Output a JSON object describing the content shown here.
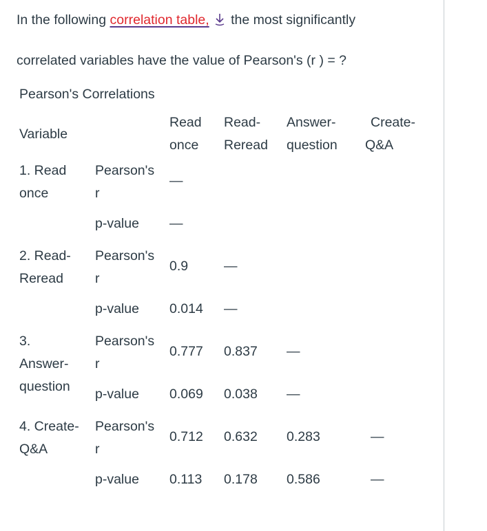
{
  "question": {
    "part1_prefix": "In the following ",
    "link_text": "correlation table,",
    "download_icon": "download-arrow-icon",
    "part1_suffix": " the most significantly",
    "part2": "correlated variables have the value of Pearson's (r ) = ?"
  },
  "table": {
    "caption": "Pearson's Correlations",
    "headers": {
      "variable": "Variable",
      "columns": [
        {
          "line1": "Read",
          "line2": "once"
        },
        {
          "line1": "Read-",
          "line2": "Reread"
        },
        {
          "line1": "Answer-",
          "line2": "question"
        },
        {
          "line1": "Create-",
          "line2": "Q&A"
        }
      ]
    },
    "rows": [
      {
        "variable_lines": [
          "1. Read",
          "once"
        ],
        "pearson_label": [
          "Pearson's",
          "r"
        ],
        "pearson": [
          "—",
          "",
          "",
          ""
        ],
        "p_label": "p-value",
        "p": [
          "—",
          "",
          "",
          ""
        ]
      },
      {
        "variable_lines": [
          "2. Read-",
          "Reread"
        ],
        "pearson_label": [
          "Pearson's",
          "r"
        ],
        "pearson": [
          "0.9",
          "—",
          "",
          ""
        ],
        "p_label": "p-value",
        "p": [
          "0.014",
          "—",
          "",
          ""
        ]
      },
      {
        "variable_lines": [
          "3.",
          "Answer-",
          "question"
        ],
        "pearson_label": [
          "Pearson's",
          "r"
        ],
        "pearson": [
          "0.777",
          "0.837",
          "—",
          ""
        ],
        "p_label": "p-value",
        "p": [
          "0.069",
          "0.038",
          "—",
          ""
        ]
      },
      {
        "variable_lines": [
          "4. Create-",
          "Q&A"
        ],
        "pearson_label": [
          "Pearson's",
          "r"
        ],
        "pearson": [
          "0.712",
          "0.632",
          "0.283",
          "—"
        ],
        "p_label": "p-value",
        "p": [
          "0.113",
          "0.178",
          "0.586",
          "—"
        ]
      }
    ]
  }
}
